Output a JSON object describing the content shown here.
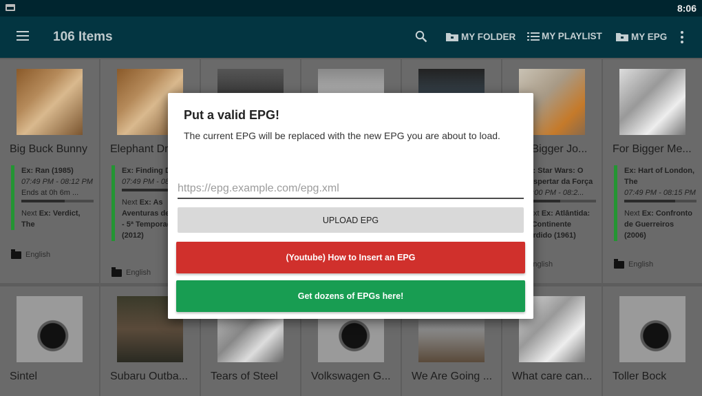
{
  "status_bar": {
    "time": "8:06"
  },
  "app_bar": {
    "title": "106 Items",
    "actions": [
      {
        "label": "MY FOLDER",
        "icon": "folder-icon"
      },
      {
        "label": "MY PLAYLIST",
        "icon": "playlist-icon"
      },
      {
        "label": "MY EPG",
        "icon": "folder-icon"
      }
    ]
  },
  "grid": {
    "row1": [
      {
        "title": "Big Buck Bunny",
        "now": "Ex: Ran (1985)",
        "time": "07:49 PM - 08:12 PM",
        "ends": "Ends at 0h 6m ...",
        "progress": 0.6,
        "next_prefix": "Next",
        "next": "Ex: Verdict, The",
        "language": "English"
      },
      {
        "title": "Elephant Dream",
        "now": "Ex: Finding Dory",
        "time": "07:49 PM - 08:12 PM",
        "next_prefix": "Next",
        "next": "Ex: As Aventuras de Merlin - 5ª Temporada (2012)",
        "progress": 0.7,
        "language": "English"
      },
      {
        "title": "",
        "language": ""
      },
      {
        "title": "",
        "language": ""
      },
      {
        "title": "",
        "language": ""
      },
      {
        "title": "For Bigger Jo...",
        "now": "Ex: Star Wars: O Despertar da Força",
        "time": "08:00 PM - 08:2...",
        "next_prefix": "Next",
        "next": "Ex: Atlântida: O Continente Perdido (1961)",
        "progress": 0.5,
        "language": "English"
      },
      {
        "title": "For Bigger Me...",
        "now": "Ex: Hart of London, The",
        "time": "07:49 PM - 08:15 PM",
        "next_prefix": "Next",
        "next": "Ex: Confronto de Guerreiros (2006)",
        "progress": 0.7,
        "language": "English"
      }
    ],
    "row2": [
      {
        "title": "Sintel"
      },
      {
        "title": "Subaru Outba..."
      },
      {
        "title": "Tears of Steel"
      },
      {
        "title": "Volkswagen G..."
      },
      {
        "title": "We Are Going ..."
      },
      {
        "title": "What care can..."
      },
      {
        "title": "Toller Bock"
      }
    ]
  },
  "dialog": {
    "title": "Put a valid EPG!",
    "message": "The current EPG will be replaced with the new EPG you are about to load.",
    "input_value": "",
    "input_placeholder": "https://epg.example.com/epg.xml",
    "upload_label": "UPLOAD EPG",
    "youtube_label": "(Youtube) How to Insert an EPG",
    "get_label": "Get dozens of EPGs here!"
  },
  "colors": {
    "app_bar": "#033541",
    "progress_green": "#239532",
    "youtube_button": "#d0302c",
    "get_button": "#189d52",
    "upload_button": "#d9d9d9"
  }
}
